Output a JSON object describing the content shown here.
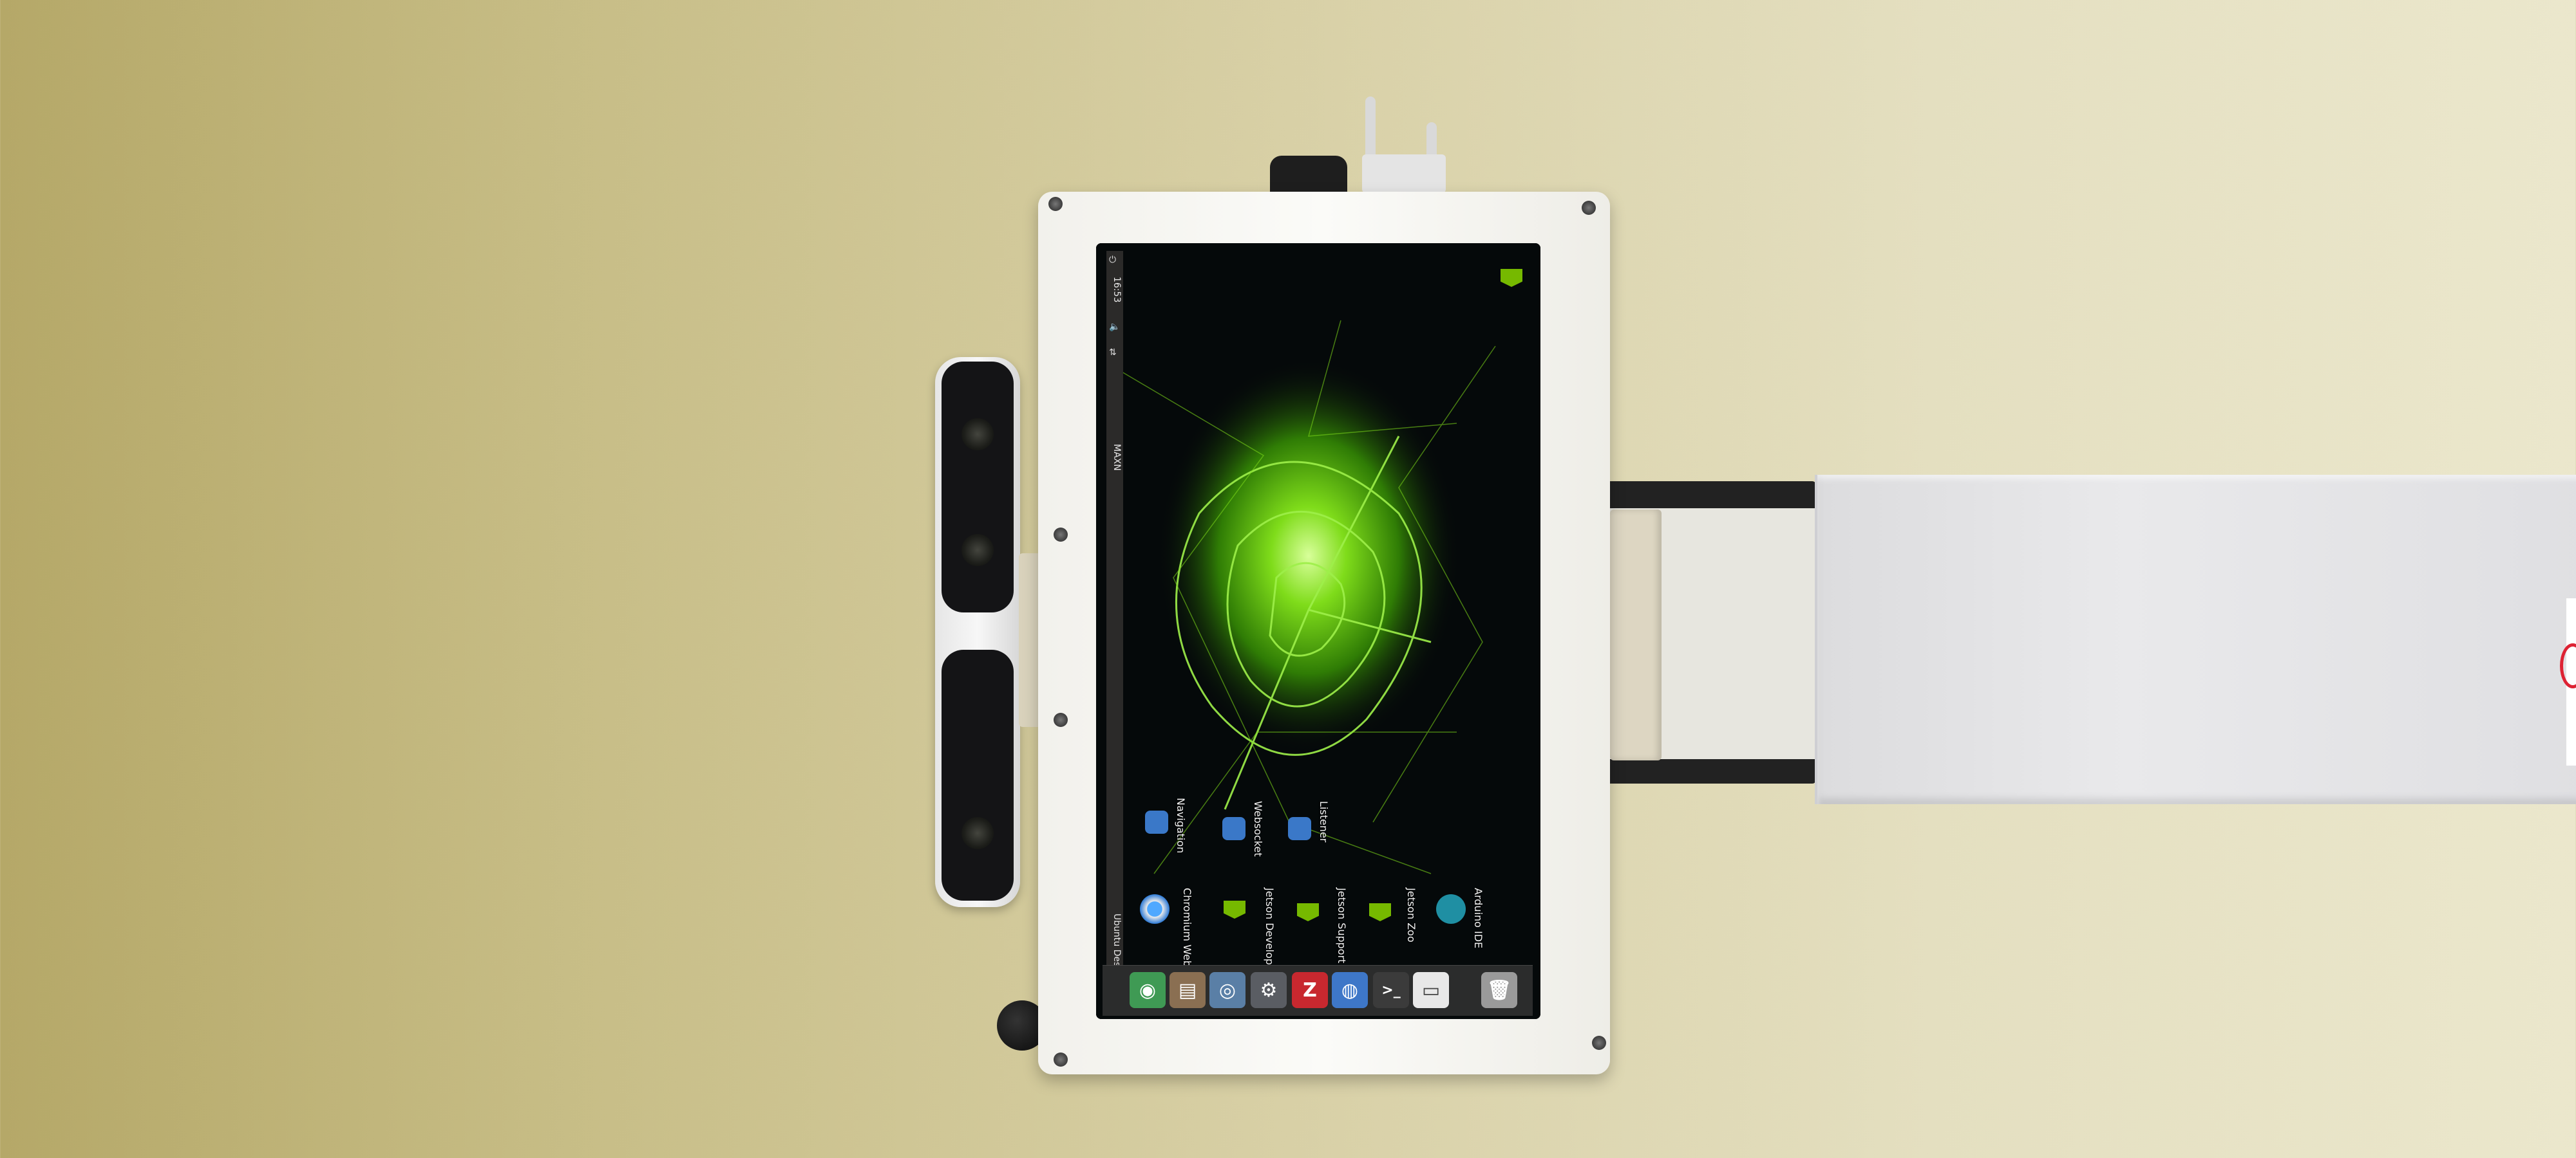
{
  "top_panel": {
    "title": "Ubuntu Desktop",
    "power_mode": "MAXN",
    "clock": "16:53"
  },
  "desktop_icons": [
    {
      "label": "Chromium Web Browser",
      "icon": "chromium-icon"
    },
    {
      "label": "Navigation",
      "icon": "robot-app-icon"
    },
    {
      "label": "Jetson Developer Zone",
      "icon": "nvidia-icon"
    },
    {
      "label": "Websocket",
      "icon": "robot-app-icon"
    },
    {
      "label": "Jetson Support Forums",
      "icon": "nvidia-icon"
    },
    {
      "label": "Listener",
      "icon": "robot-app-icon"
    },
    {
      "label": "Jetson Zoo",
      "icon": "nvidia-icon"
    },
    {
      "label": "Arduino IDE",
      "icon": "arduino-icon"
    }
  ],
  "launcher_items": [
    {
      "name": "chromium",
      "glyph": "◉",
      "color": "#3f9a54"
    },
    {
      "name": "files",
      "glyph": "▤",
      "color": "#8a6f52"
    },
    {
      "name": "system-monitor",
      "glyph": "◎",
      "color": "#5a7fa6"
    },
    {
      "name": "settings",
      "glyph": "⚙",
      "color": "#5a5d63"
    },
    {
      "name": "filezilla",
      "glyph": "Z",
      "color": "#c8282f"
    },
    {
      "name": "software",
      "glyph": "◍",
      "color": "#3e77c8"
    },
    {
      "name": "terminal",
      "glyph": ">_",
      "color": "#3b3b3b"
    },
    {
      "name": "text-editor",
      "glyph": "▭",
      "color": "#e8e8e8"
    },
    {
      "name": "trash",
      "glyph": "🗑",
      "color": "#9a9a9a"
    }
  ],
  "colors": {
    "nvidia_green": "#76b900",
    "panel": "#2b2a29",
    "screen_bg": "#060a0a"
  }
}
